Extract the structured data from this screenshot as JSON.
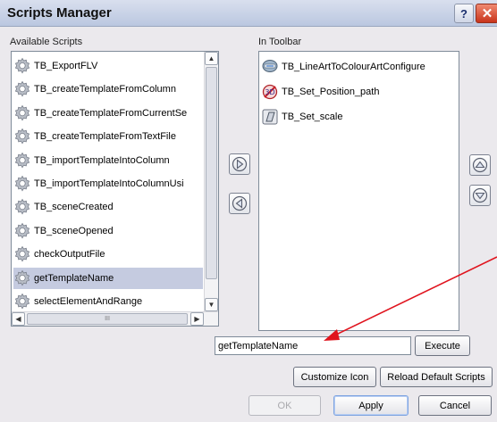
{
  "window": {
    "title": "Scripts Manager",
    "help_label": "?",
    "close_label": "✕"
  },
  "available": {
    "label": "Available Scripts",
    "items": [
      {
        "label": "TB_ExportFLV",
        "icon": "gear-icon"
      },
      {
        "label": "TB_createTemplateFromColumn",
        "icon": "gear-icon"
      },
      {
        "label": "TB_createTemplateFromCurrentSe",
        "icon": "gear-icon"
      },
      {
        "label": "TB_createTemplateFromTextFile",
        "icon": "gear-icon"
      },
      {
        "label": "TB_importTemplateIntoColumn",
        "icon": "gear-icon"
      },
      {
        "label": "TB_importTemplateIntoColumnUsi",
        "icon": "gear-icon"
      },
      {
        "label": "TB_sceneCreated",
        "icon": "gear-icon"
      },
      {
        "label": "TB_sceneOpened",
        "icon": "gear-icon"
      },
      {
        "label": "checkOutputFile",
        "icon": "gear-icon"
      },
      {
        "label": "getTemplateName",
        "icon": "gear-icon",
        "selected": true
      },
      {
        "label": "selectElementAndRange",
        "icon": "gear-icon"
      }
    ],
    "hscroll_grip": "III"
  },
  "toolbar": {
    "label": "In Toolbar",
    "items": [
      {
        "label": "TB_LineArtToColourArtConfigure",
        "icon": "lineart-config-icon"
      },
      {
        "label": "TB_Set_Position_path",
        "icon": "position-path-icon"
      },
      {
        "label": "TB_Set_scale",
        "icon": "scale-icon"
      }
    ]
  },
  "script_name": {
    "value": "getTemplateName"
  },
  "buttons": {
    "execute": "Execute",
    "customize_icon": "Customize Icon",
    "reload_default": "Reload Default Scripts",
    "ok": "OK",
    "apply": "Apply",
    "cancel": "Cancel"
  },
  "colors": {
    "annotation_arrow": "#e0141e",
    "selection": "#c5cbe0"
  }
}
